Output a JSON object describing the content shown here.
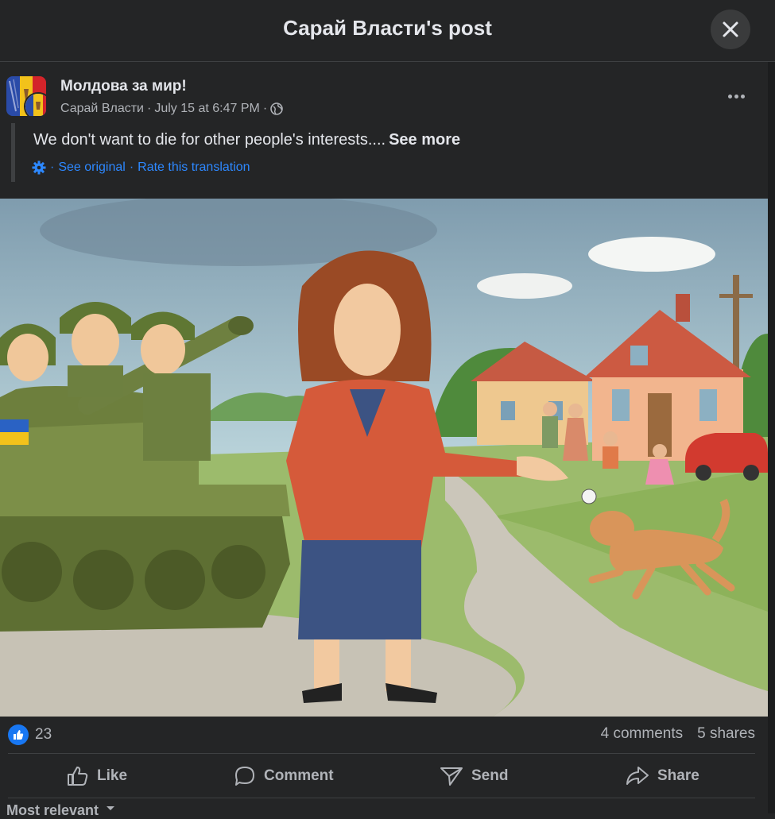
{
  "header": {
    "title": "Сарай Власти's post"
  },
  "post": {
    "author": "Молдова за мир!",
    "page": "Сарай Власти",
    "separator": "·",
    "timestamp": "July 15 at 6:47 PM",
    "text": "We don't want to die for other people's interests....",
    "see_more": "See more",
    "see_original": "See original",
    "rate_translation": "Rate this translation"
  },
  "stats": {
    "reactions": "23",
    "comments": "4 comments",
    "shares": "5 shares"
  },
  "actions": {
    "like": "Like",
    "comment": "Comment",
    "send": "Send",
    "share": "Share"
  },
  "comments": {
    "sort": "Most relevant"
  },
  "colors": {
    "background": "#242526",
    "text": "#e4e6eb",
    "muted": "#b0b3b8",
    "link": "#2d88ff",
    "like_badge": "#1877f2"
  },
  "icons": [
    "close-icon",
    "more-icon",
    "globe-icon",
    "gear-icon",
    "thumbs-up-icon",
    "comment-icon",
    "send-icon",
    "share-icon",
    "chevron-down-icon"
  ]
}
